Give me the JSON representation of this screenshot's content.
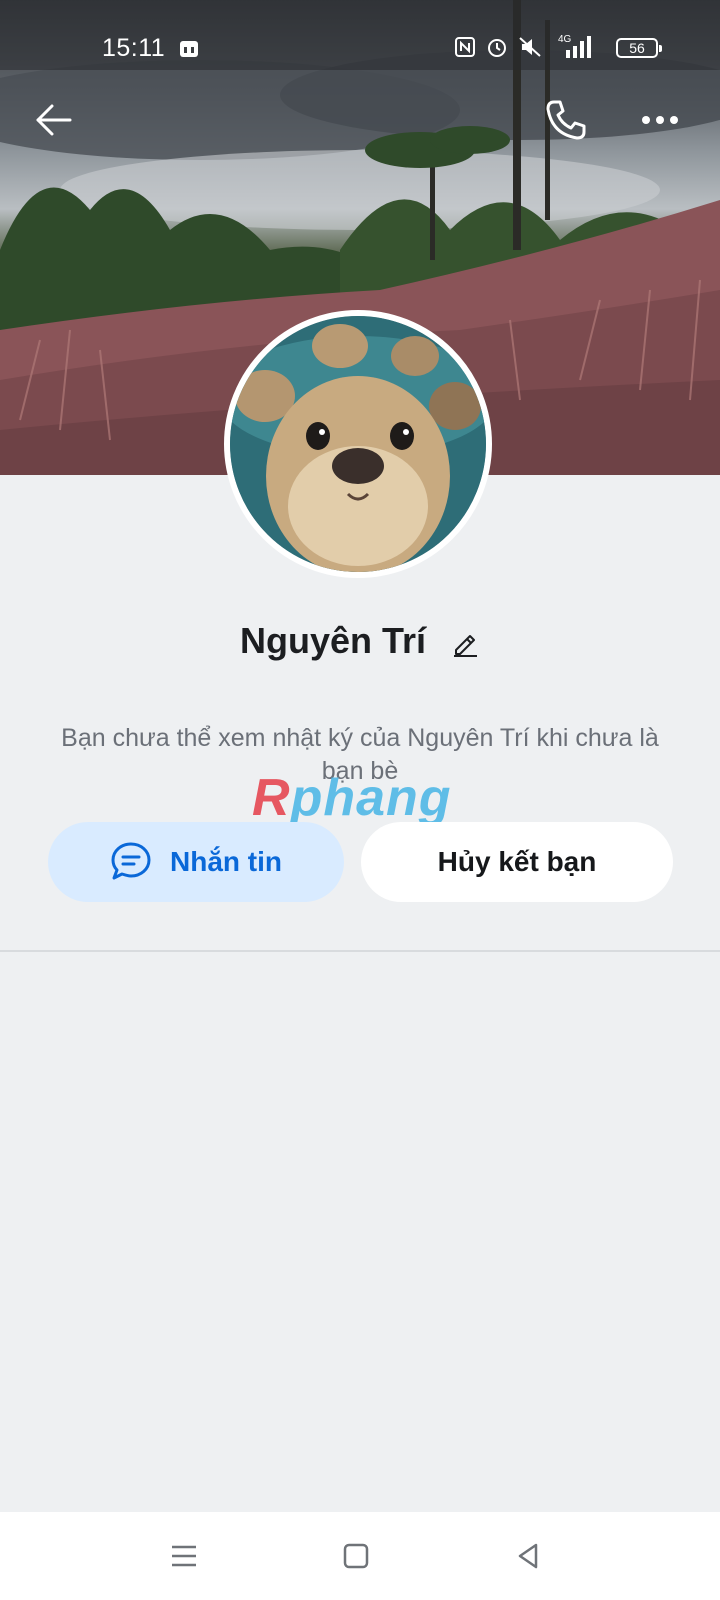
{
  "status_bar": {
    "time": "15:11",
    "battery": "56",
    "icons": [
      "store-icon",
      "nfc-icon",
      "alarm-icon",
      "mute-icon",
      "signal-4g-icon",
      "battery-icon"
    ]
  },
  "header": {
    "back_icon": "arrow-left-icon",
    "call_icon": "phone-icon",
    "more_icon": "more-dots-icon"
  },
  "profile": {
    "name": "Nguyên Trí",
    "edit_icon": "pencil-icon",
    "privacy_notice": "Bạn chưa thể xem nhật ký của Nguyên Trí khi chưa là bạn bè"
  },
  "watermark": {
    "part1": "R",
    "part2": "phang"
  },
  "actions": {
    "message_label": "Nhắn tin",
    "message_icon": "chat-bubble-icon",
    "unfriend_label": "Hủy kết bạn"
  },
  "colors": {
    "primary": "#0a68d8",
    "message_bg": "#d9ebff",
    "page_bg": "#eef0f2"
  },
  "nav_bar": {
    "icons": [
      "menu-icon",
      "home-square-icon",
      "back-triangle-icon"
    ]
  }
}
